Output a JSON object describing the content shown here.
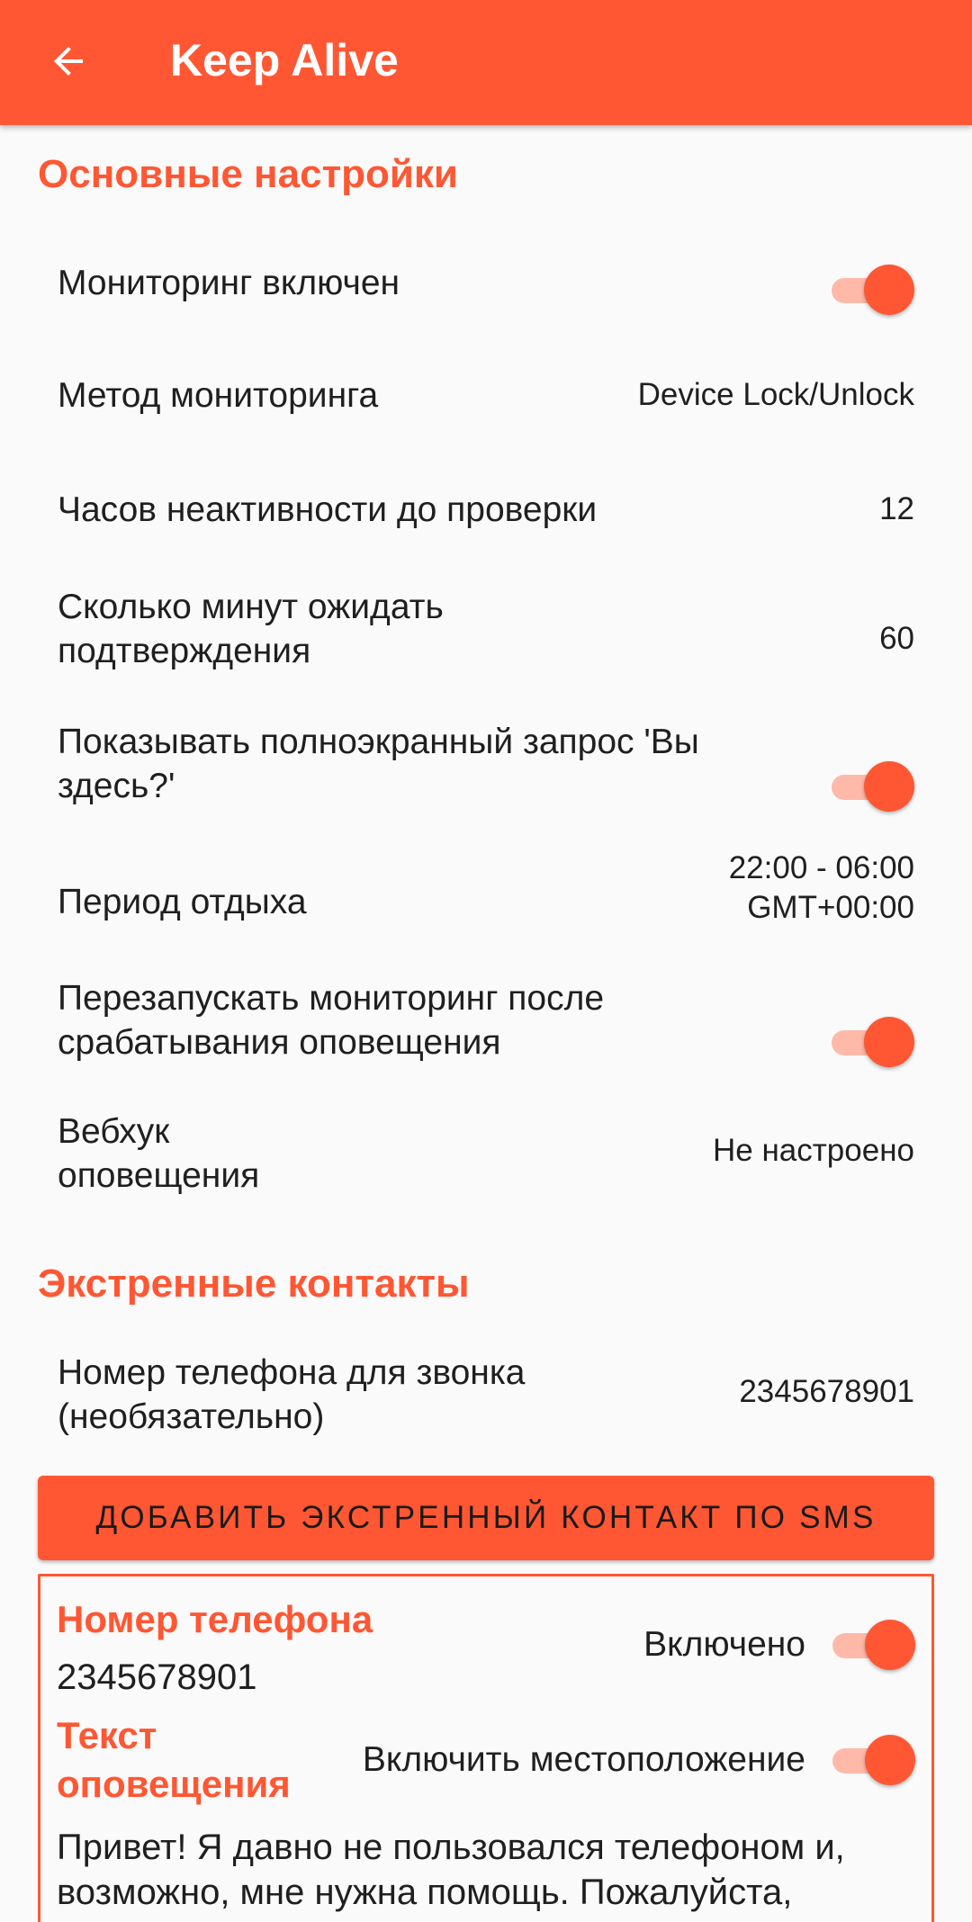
{
  "app_bar": {
    "title": "Keep Alive",
    "back_icon": "arrow-back-icon"
  },
  "colors": {
    "accent": "#FF5733",
    "track": "#FFB9A8"
  },
  "sections": {
    "basic": {
      "header": "Основные настройки",
      "monitoring_enabled": {
        "label": "Мониторинг включен",
        "on": true
      },
      "monitoring_method": {
        "label": "Метод мониторинга",
        "value": "Device Lock/Unlock"
      },
      "inactivity_hours": {
        "label": "Часов неактивности до проверки",
        "value": "12"
      },
      "wait_minutes": {
        "label_line1": "Сколько минут ожидать",
        "label_line2": "подтверждения",
        "value": "60"
      },
      "fullscreen_prompt": {
        "label_line1": "Показывать полноэкранный запрос 'Вы",
        "label_line2": "здесь?'",
        "on": true
      },
      "rest_period": {
        "label": "Период отдыха",
        "value_line1": "22:00 - 06:00",
        "value_line2": "GMT+00:00"
      },
      "restart_monitoring": {
        "label_line1": "Перезапускать мониторинг после",
        "label_line2": "срабатывания оповещения",
        "on": true
      },
      "webhook": {
        "label_line1": "Вебхук",
        "label_line2": "оповещения",
        "value": "Не настроено"
      }
    },
    "emergency": {
      "header": "Экстренные контакты",
      "call_phone": {
        "label_line1": "Номер телефона для звонка",
        "label_line2": "(необязательно)",
        "value": "2345678901"
      },
      "add_sms_button": "ДОБАВИТЬ ЭКСТРЕННЫЙ КОНТАКТ ПО SMS",
      "contact_card": {
        "phone_label": "Номер телефона",
        "phone_value": "2345678901",
        "enabled_label": "Включено",
        "enabled_on": true,
        "alert_text_label_line1": "Текст",
        "alert_text_label_line2": "оповещения",
        "location_label": "Включить местоположение",
        "location_on": true,
        "alert_text_line1": "Привет! Я давно не пользовался телефоном и,",
        "alert_text_line2": "возможно, мне нужна помощь. Пожалуйста,"
      }
    }
  }
}
